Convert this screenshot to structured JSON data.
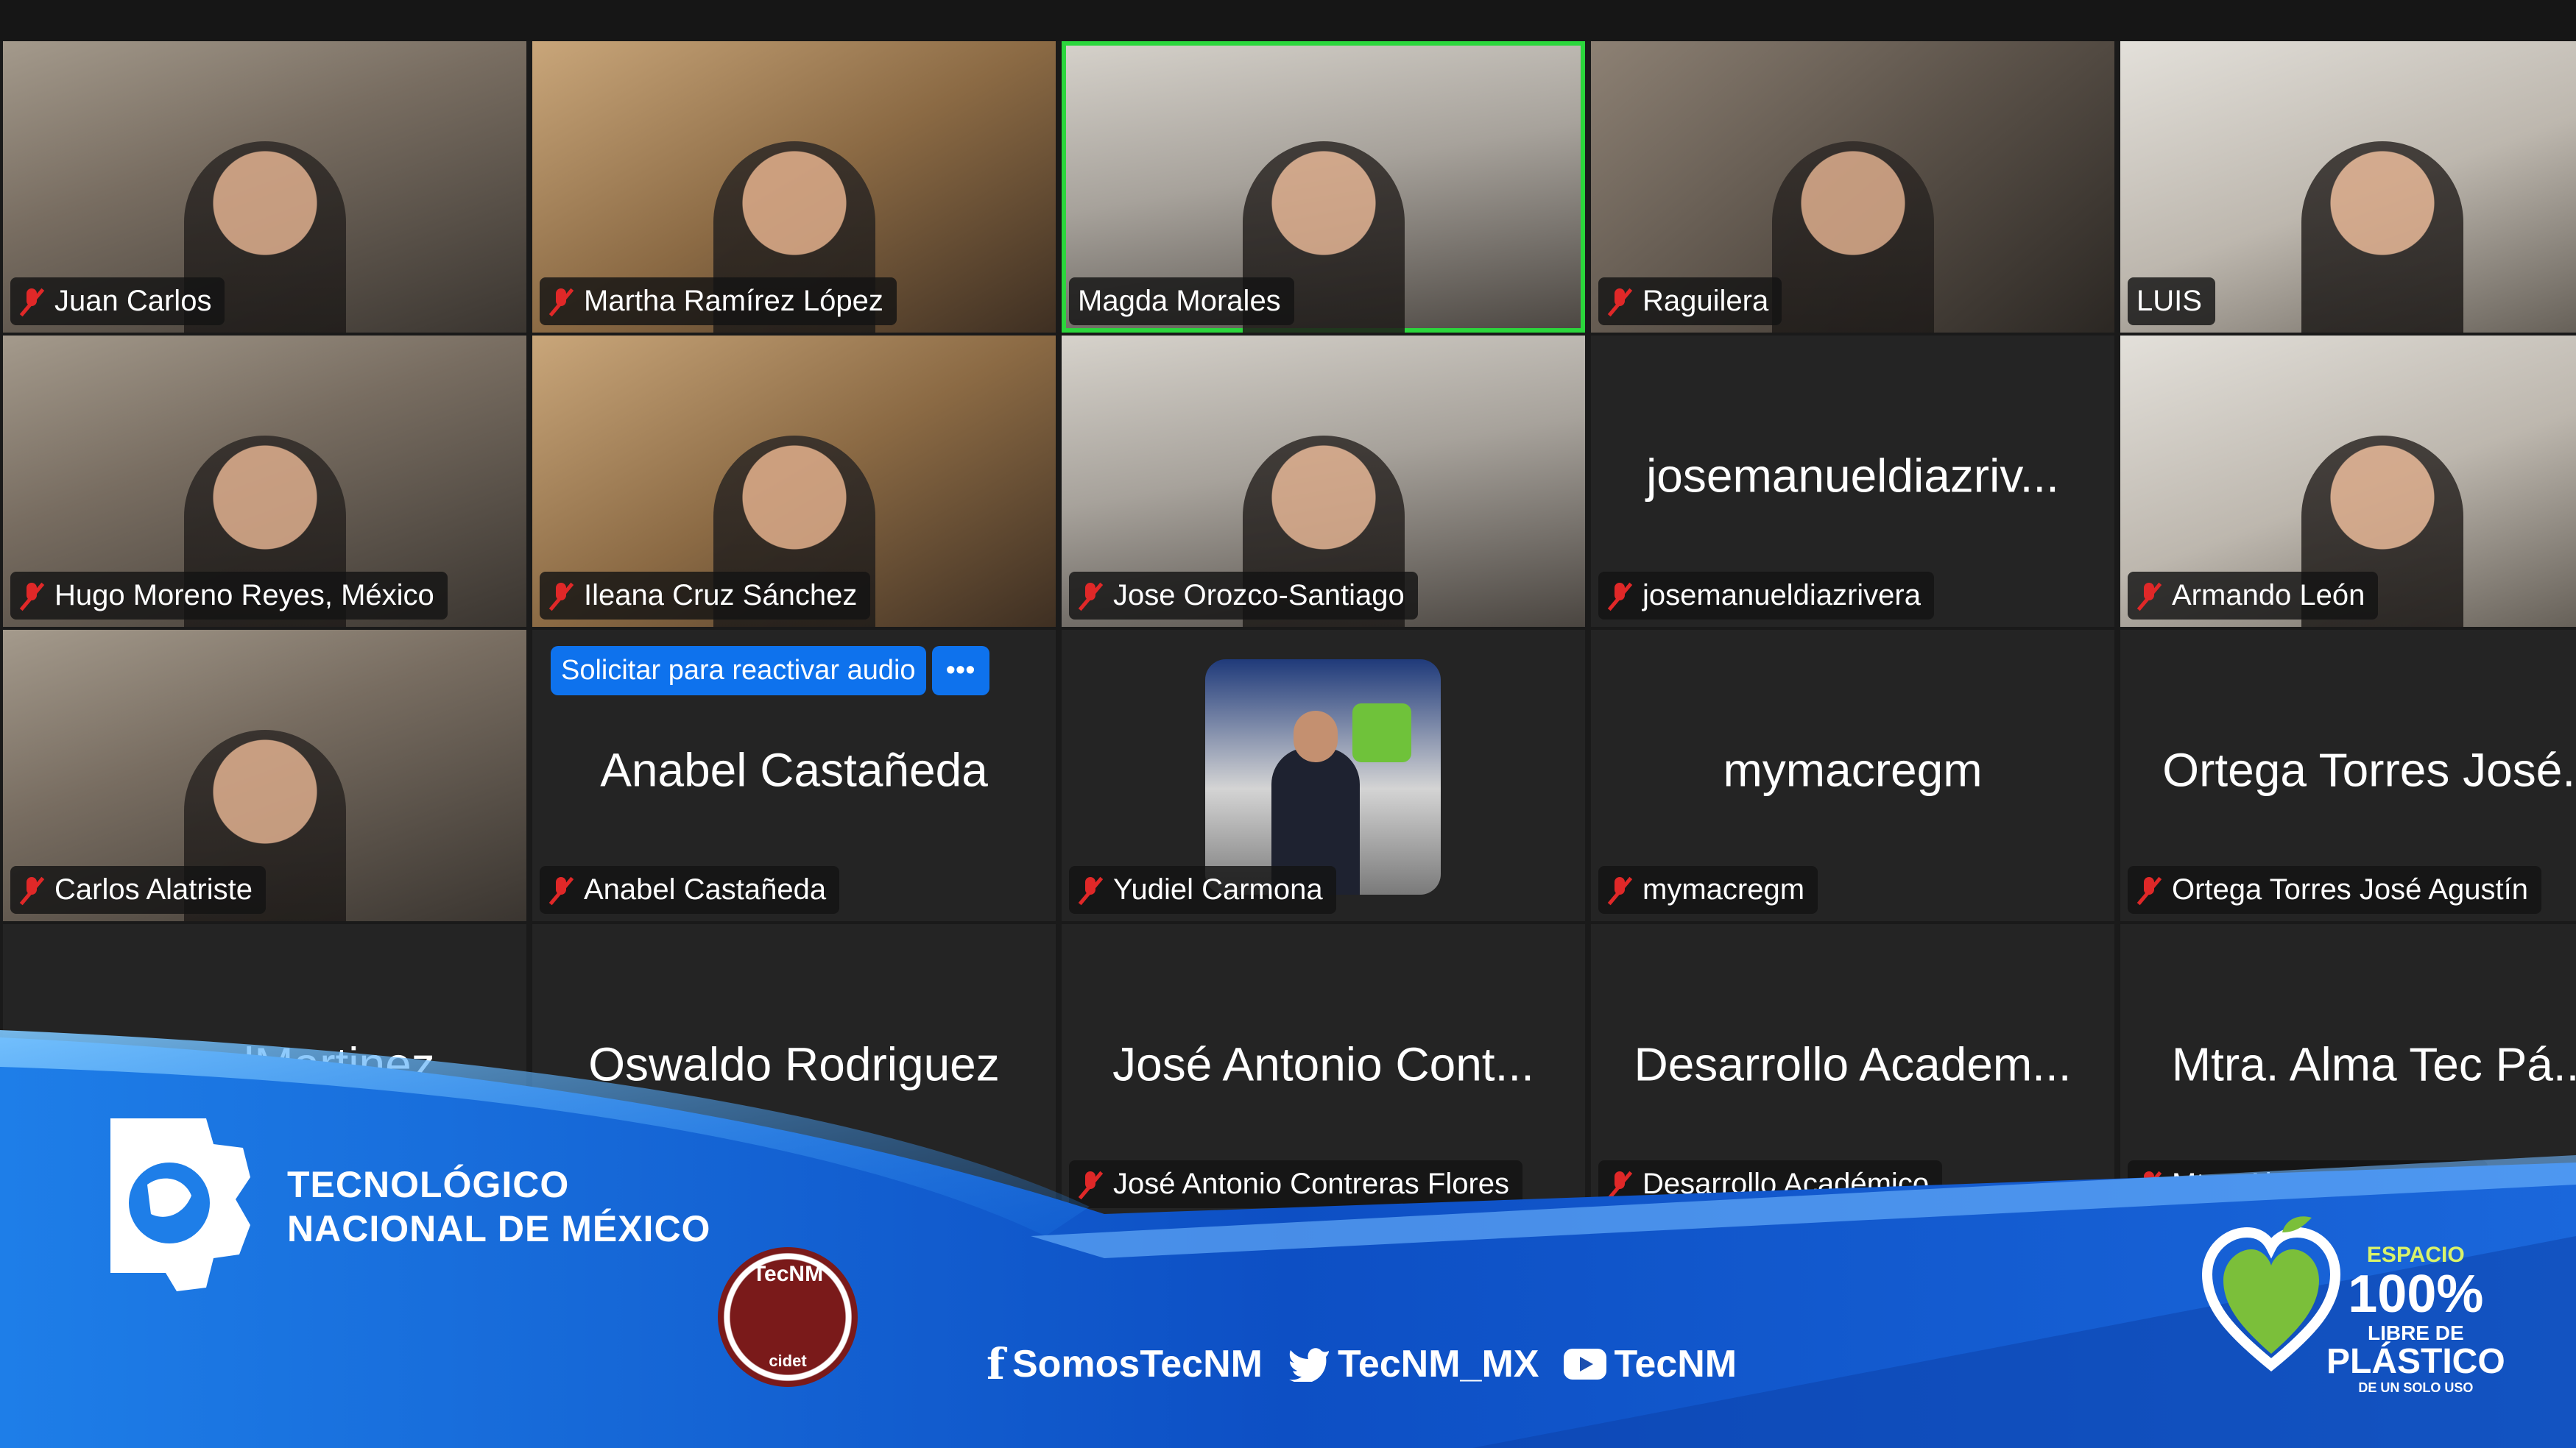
{
  "tiles": [
    {
      "name": "Juan Carlos",
      "muted": true,
      "type": "video"
    },
    {
      "name": "Martha Ramírez López",
      "muted": true,
      "type": "video"
    },
    {
      "name": "Magda Morales",
      "muted": false,
      "type": "video",
      "active": true
    },
    {
      "name": "Raguilera",
      "muted": true,
      "type": "video"
    },
    {
      "name": "LUIS",
      "muted": false,
      "type": "video"
    },
    {
      "name": "Hugo Moreno Reyes, México",
      "muted": true,
      "type": "video"
    },
    {
      "name": "Ileana Cruz Sánchez",
      "muted": true,
      "type": "video"
    },
    {
      "name": "Jose Orozco-Santiago",
      "muted": true,
      "type": "video"
    },
    {
      "name": "josemanueldiazrivera",
      "display": "josemanueldiazriv...",
      "muted": true,
      "type": "name"
    },
    {
      "name": "Armando León",
      "muted": true,
      "type": "video"
    },
    {
      "name": "Carlos Alatriste",
      "muted": true,
      "type": "video"
    },
    {
      "name": "Anabel Castañeda",
      "display": "Anabel Castañeda",
      "muted": true,
      "type": "name"
    },
    {
      "name": "Yudiel Carmona",
      "muted": true,
      "type": "avatar"
    },
    {
      "name": "mymacregm",
      "display": "mymacregm",
      "muted": true,
      "type": "name"
    },
    {
      "name": "Ortega Torres José Agustín",
      "display": "Ortega Torres José...",
      "muted": true,
      "type": "name"
    },
    {
      "name": "",
      "display": "SamuelMartinez",
      "muted": false,
      "type": "name"
    },
    {
      "name": "",
      "display": "Oswaldo Rodriguez",
      "muted": false,
      "type": "name"
    },
    {
      "name": "José Antonio Contreras Flores",
      "display": "José Antonio Cont...",
      "muted": true,
      "type": "name"
    },
    {
      "name": "Desarrollo Académico",
      "display": "Desarrollo Academ...",
      "muted": true,
      "type": "name"
    },
    {
      "name": "Mtra. Alma Tec Pánuco",
      "display": "Mtra. Alma Tec Pá...",
      "muted": true,
      "type": "name"
    }
  ],
  "unmute": {
    "label": "Solicitar para reactivar audio",
    "more": "•••"
  },
  "overlay": {
    "brand_line1": "TECNOLÓGICO",
    "brand_line2": "NACIONAL DE MÉXICO",
    "seal_text": "TecNM",
    "seal_sub": "cidet",
    "social_facebook": "SomosTecNM",
    "social_twitter": "TecNM_MX",
    "social_youtube": "TecNM",
    "plastic_line1": "ESPACIO",
    "plastic_line2": "100%",
    "plastic_line3": "LIBRE DE",
    "plastic_line4": "PLÁSTICO",
    "plastic_line5": "DE UN SOLO USO",
    "colors": {
      "overlay_blue": "#1c6fe0",
      "active_border": "#2bd63c",
      "unmute_blue": "#0e72ed",
      "muted_red": "#e02828"
    }
  }
}
